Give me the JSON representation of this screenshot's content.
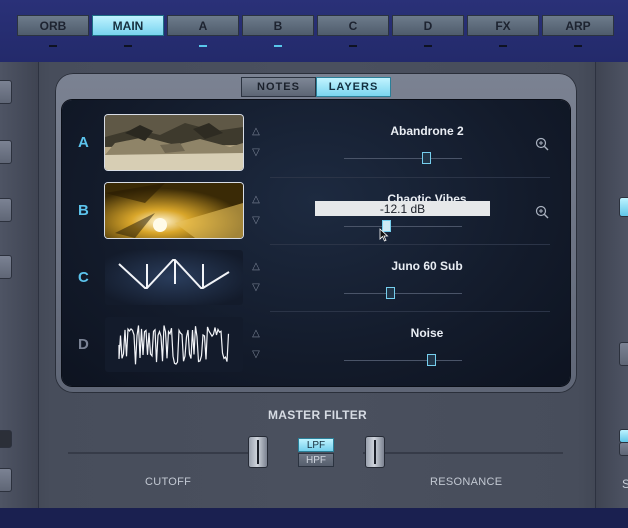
{
  "top_tabs": [
    {
      "label": "ORB",
      "active": false,
      "indicator": false
    },
    {
      "label": "MAIN",
      "active": true,
      "indicator": false
    },
    {
      "label": "A",
      "active": false,
      "indicator": true
    },
    {
      "label": "B",
      "active": false,
      "indicator": true
    },
    {
      "label": "C",
      "active": false,
      "indicator": false
    },
    {
      "label": "D",
      "active": false,
      "indicator": false
    },
    {
      "label": "FX",
      "active": false,
      "indicator": false
    },
    {
      "label": "ARP",
      "active": false,
      "indicator": false
    }
  ],
  "view_toggle": {
    "notes": "NOTES",
    "layers": "LAYERS",
    "active": "LAYERS"
  },
  "layers": [
    {
      "letter": "A",
      "sound": "Abandrone 2",
      "thumb": "photo-rubble",
      "level": 0.7,
      "letter_active": true,
      "zoom": true
    },
    {
      "letter": "B",
      "sound": "Chaotic Vibes",
      "thumb": "photo-gold-light",
      "level": 0.36,
      "letter_active": true,
      "zoom": true,
      "tooltip": "-12.1 dB"
    },
    {
      "letter": "C",
      "sound": "Juno 60 Sub",
      "thumb": "sawtooth-wave",
      "level": 0.39,
      "letter_active": true,
      "zoom": false
    },
    {
      "letter": "D",
      "sound": "Noise",
      "thumb": "noise-wave",
      "level": 0.74,
      "letter_active": false,
      "zoom": false
    }
  ],
  "master_filter": {
    "title": "MASTER FILTER",
    "cutoff_label": "CUTOFF",
    "resonance_label": "RESONANCE",
    "lpf": "LPF",
    "hpf": "HPF",
    "selected": "LPF",
    "cutoff_level": 1.0,
    "resonance_level": 0.0
  },
  "right_edge_text": "S",
  "colors": {
    "accent": "#59c8ec",
    "tab_bar": "#262d70"
  }
}
